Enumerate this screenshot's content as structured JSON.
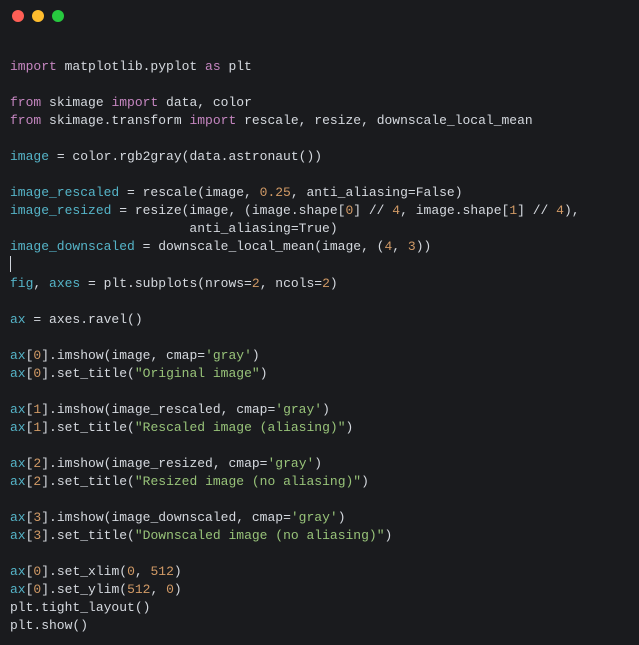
{
  "titlebar": {
    "red": "close",
    "yellow": "minimize",
    "green": "zoom"
  },
  "code": {
    "l01a": "import",
    "l01b": " matplotlib.pyplot ",
    "l01c": "as",
    "l01d": " plt",
    "l02": "",
    "l03a": "from",
    "l03b": " skimage ",
    "l03c": "import",
    "l03d": " data, color",
    "l04a": "from",
    "l04b": " skimage.transform ",
    "l04c": "import",
    "l04d": " rescale, resize, downscale_local_mean",
    "l05": "",
    "l06a": "image",
    "l06b": " = color.rgb2gray(data.astronaut())",
    "l07": "",
    "l08a": "image_rescaled",
    "l08b": " = rescale(image, ",
    "l08c": "0.25",
    "l08d": ", anti_aliasing=False)",
    "l09a": "image_resized",
    "l09b": " = resize(image, (image.shape[",
    "l09c": "0",
    "l09d": "] // ",
    "l09e": "4",
    "l09f": ", image.shape[",
    "l09g": "1",
    "l09h": "] // ",
    "l09i": "4",
    "l09j": "),",
    "l10a": "                       anti_aliasing=True)",
    "l11a": "image_downscaled",
    "l11b": " = downscale_local_mean(image, (",
    "l11c": "4",
    "l11d": ", ",
    "l11e": "3",
    "l11f": "))",
    "l12": "",
    "l13a": "fig",
    "l13b": ", ",
    "l13c": "axes",
    "l13d": " = plt.subplots(nrows=",
    "l13e": "2",
    "l13f": ", ncols=",
    "l13g": "2",
    "l13h": ")",
    "l14": "",
    "l15a": "ax",
    "l15b": " = axes.ravel()",
    "l16": "",
    "l17a": "ax",
    "l17b": "[",
    "l17c": "0",
    "l17d": "].imshow(image, cmap=",
    "l17e": "'gray'",
    "l17f": ")",
    "l18a": "ax",
    "l18b": "[",
    "l18c": "0",
    "l18d": "].set_title(",
    "l18e": "\"Original image\"",
    "l18f": ")",
    "l19": "",
    "l20a": "ax",
    "l20b": "[",
    "l20c": "1",
    "l20d": "].imshow(image_rescaled, cmap=",
    "l20e": "'gray'",
    "l20f": ")",
    "l21a": "ax",
    "l21b": "[",
    "l21c": "1",
    "l21d": "].set_title(",
    "l21e": "\"Rescaled image (aliasing)\"",
    "l21f": ")",
    "l22": "",
    "l23a": "ax",
    "l23b": "[",
    "l23c": "2",
    "l23d": "].imshow(image_resized, cmap=",
    "l23e": "'gray'",
    "l23f": ")",
    "l24a": "ax",
    "l24b": "[",
    "l24c": "2",
    "l24d": "].set_title(",
    "l24e": "\"Resized image (no aliasing)\"",
    "l24f": ")",
    "l25": "",
    "l26a": "ax",
    "l26b": "[",
    "l26c": "3",
    "l26d": "].imshow(image_downscaled, cmap=",
    "l26e": "'gray'",
    "l26f": ")",
    "l27a": "ax",
    "l27b": "[",
    "l27c": "3",
    "l27d": "].set_title(",
    "l27e": "\"Downscaled image (no aliasing)\"",
    "l27f": ")",
    "l28": "",
    "l29a": "ax",
    "l29b": "[",
    "l29c": "0",
    "l29d": "].set_xlim(",
    "l29e": "0",
    "l29f": ", ",
    "l29g": "512",
    "l29h": ")",
    "l30a": "ax",
    "l30b": "[",
    "l30c": "0",
    "l30d": "].set_ylim(",
    "l30e": "512",
    "l30f": ", ",
    "l30g": "0",
    "l30h": ")",
    "l31a": "plt.tight_layout()",
    "l32a": "plt.show()"
  }
}
